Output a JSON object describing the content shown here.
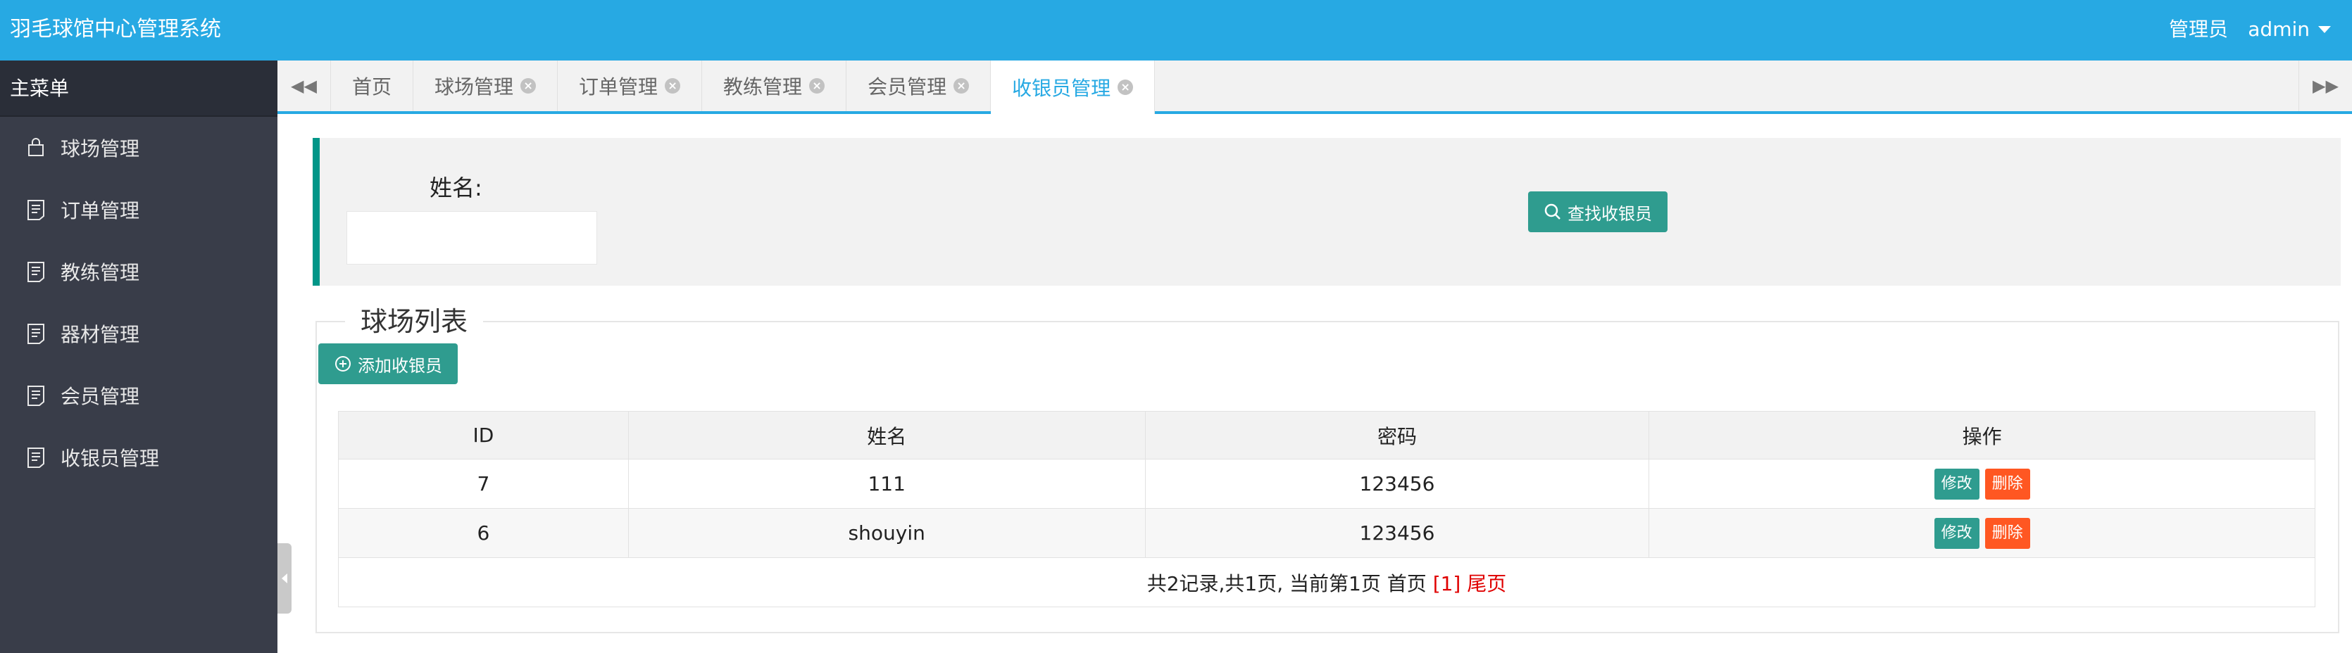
{
  "header": {
    "title": "羽毛球馆中心管理系统",
    "role": "管理员",
    "user": "admin"
  },
  "sidebar": {
    "heading": "主菜单",
    "items": [
      {
        "label": "球场管理",
        "icon": "bag-icon"
      },
      {
        "label": "订单管理",
        "icon": "document-icon"
      },
      {
        "label": "教练管理",
        "icon": "document-icon"
      },
      {
        "label": "器材管理",
        "icon": "document-icon"
      },
      {
        "label": "会员管理",
        "icon": "document-icon"
      },
      {
        "label": "收银员管理",
        "icon": "document-icon"
      }
    ]
  },
  "tabs": [
    {
      "label": "首页",
      "closable": false,
      "active": false
    },
    {
      "label": "球场管理",
      "closable": true,
      "active": false
    },
    {
      "label": "订单管理",
      "closable": true,
      "active": false
    },
    {
      "label": "教练管理",
      "closable": true,
      "active": false
    },
    {
      "label": "会员管理",
      "closable": true,
      "active": false
    },
    {
      "label": "收银员管理",
      "closable": true,
      "active": true
    }
  ],
  "search": {
    "label": "姓名:",
    "value": "",
    "button": "查找收银员"
  },
  "list": {
    "legend": "球场列表",
    "add_button": "添加收银员",
    "columns": [
      "ID",
      "姓名",
      "密码",
      "操作"
    ],
    "rows": [
      {
        "id": "7",
        "name": "111",
        "password": "123456"
      },
      {
        "id": "6",
        "name": "shouyin",
        "password": "123456"
      }
    ],
    "actions": {
      "edit": "修改",
      "delete": "删除"
    },
    "pager": {
      "summary": "共2记录,共1页, 当前第1页",
      "first": "首页",
      "current": "[1]",
      "last": "尾页"
    }
  },
  "colors": {
    "header": "#27a9e3",
    "sidebar": "#393d49",
    "primary": "#2f9c8f",
    "danger": "#ff5722"
  }
}
